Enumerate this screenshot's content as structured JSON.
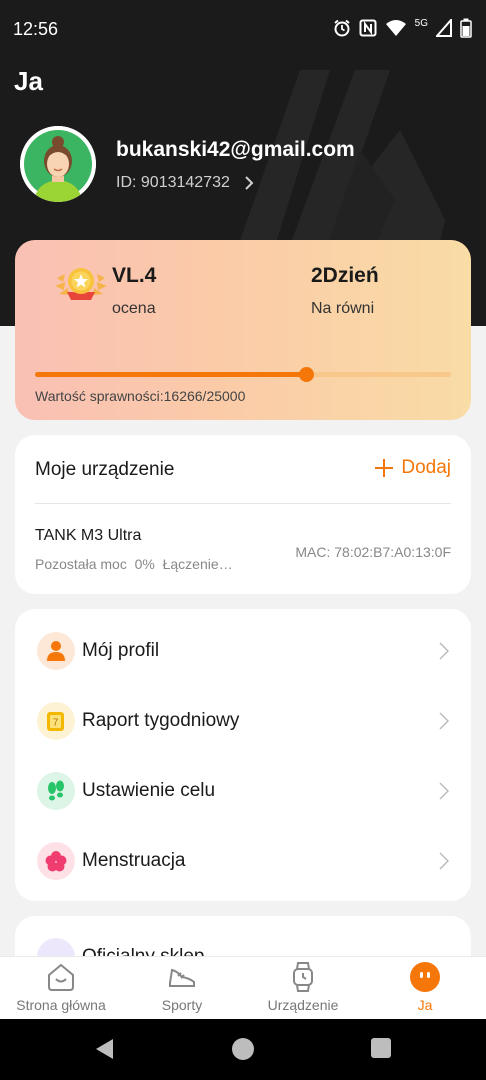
{
  "status_bar": {
    "time": "12:56",
    "network": "5G"
  },
  "page_title": "Ja",
  "profile": {
    "email": "bukanski42@gmail.com",
    "id_text": "ID: 9013142732"
  },
  "level_card": {
    "level_value": "VL.4",
    "level_label": "ocena",
    "days_value": "2Dzień",
    "days_label": "Na równi",
    "fitness_text": "Wartość sprawności:16266/25000",
    "fitness_current": 16266,
    "fitness_target": 25000
  },
  "device_card": {
    "title": "Moje urządzenie",
    "add_label": "Dodaj",
    "device_name": "TANK M3 Ultra",
    "device_status": "Pozostała moc  0%  Łączenie…",
    "device_mac": "MAC: 78:02:B7:A0:13:0F"
  },
  "menu": [
    {
      "label": "Mój profil",
      "icon": "person-icon",
      "icon_bg": "#fde8d8",
      "icon_color": "#f5770a"
    },
    {
      "label": "Raport tygodniowy",
      "icon": "calendar-icon",
      "icon_bg": "#fdf3d4",
      "icon_color": "#f5b800"
    },
    {
      "label": "Ustawienie celu",
      "icon": "footsteps-icon",
      "icon_bg": "#dcf5e6",
      "icon_color": "#28c46a"
    },
    {
      "label": "Menstruacja",
      "icon": "flower-icon",
      "icon_bg": "#fde1e7",
      "icon_color": "#f03c6e"
    }
  ],
  "partial_item": {
    "label": "Oficjalny sklep",
    "icon": "cart-icon"
  },
  "tabs": [
    {
      "label": "Strona główna",
      "icon": "home-icon",
      "active": false
    },
    {
      "label": "Sporty",
      "icon": "shoe-icon",
      "active": false
    },
    {
      "label": "Urządzenie",
      "icon": "watch-icon",
      "active": false
    },
    {
      "label": "Ja",
      "icon": "me-icon",
      "active": true
    }
  ],
  "colors": {
    "accent": "#f5770a",
    "header_bg": "#1b1b1b",
    "page_bg": "#f2f2f2"
  }
}
